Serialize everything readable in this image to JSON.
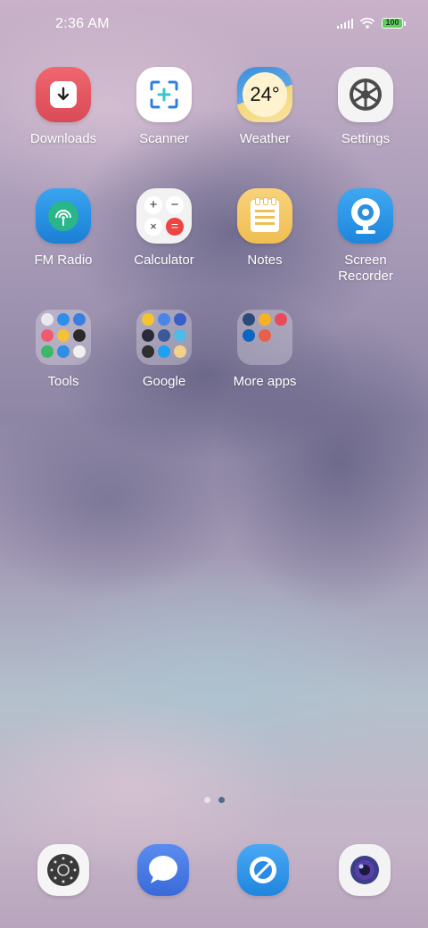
{
  "status_bar": {
    "time": "2:36 AM",
    "battery": "100",
    "icons": [
      "signal-icon",
      "wifi-icon",
      "battery-icon"
    ]
  },
  "apps": [
    {
      "label": "Downloads",
      "icon": "download-icon"
    },
    {
      "label": "Scanner",
      "icon": "scanner-icon"
    },
    {
      "label": "Weather",
      "icon": "weather-icon",
      "temperature": "24°"
    },
    {
      "label": "Settings",
      "icon": "gear-icon"
    },
    {
      "label": "FM Radio",
      "icon": "radio-icon"
    },
    {
      "label": "Calculator",
      "icon": "calculator-icon"
    },
    {
      "label": "Notes",
      "icon": "notes-icon"
    },
    {
      "label": "Screen Recorder",
      "icon": "screen-recorder-icon"
    }
  ],
  "folders": [
    {
      "label": "Tools"
    },
    {
      "label": "Google"
    },
    {
      "label": "More apps"
    }
  ],
  "page_indicator": {
    "pages": 2,
    "active_index": 1
  },
  "dock": [
    {
      "name": "phone-app",
      "icon": "dialpad-icon"
    },
    {
      "name": "messages-app",
      "icon": "message-bubble-icon"
    },
    {
      "name": "browser-app",
      "icon": "browser-icon"
    },
    {
      "name": "camera-app",
      "icon": "camera-lens-icon"
    }
  ]
}
